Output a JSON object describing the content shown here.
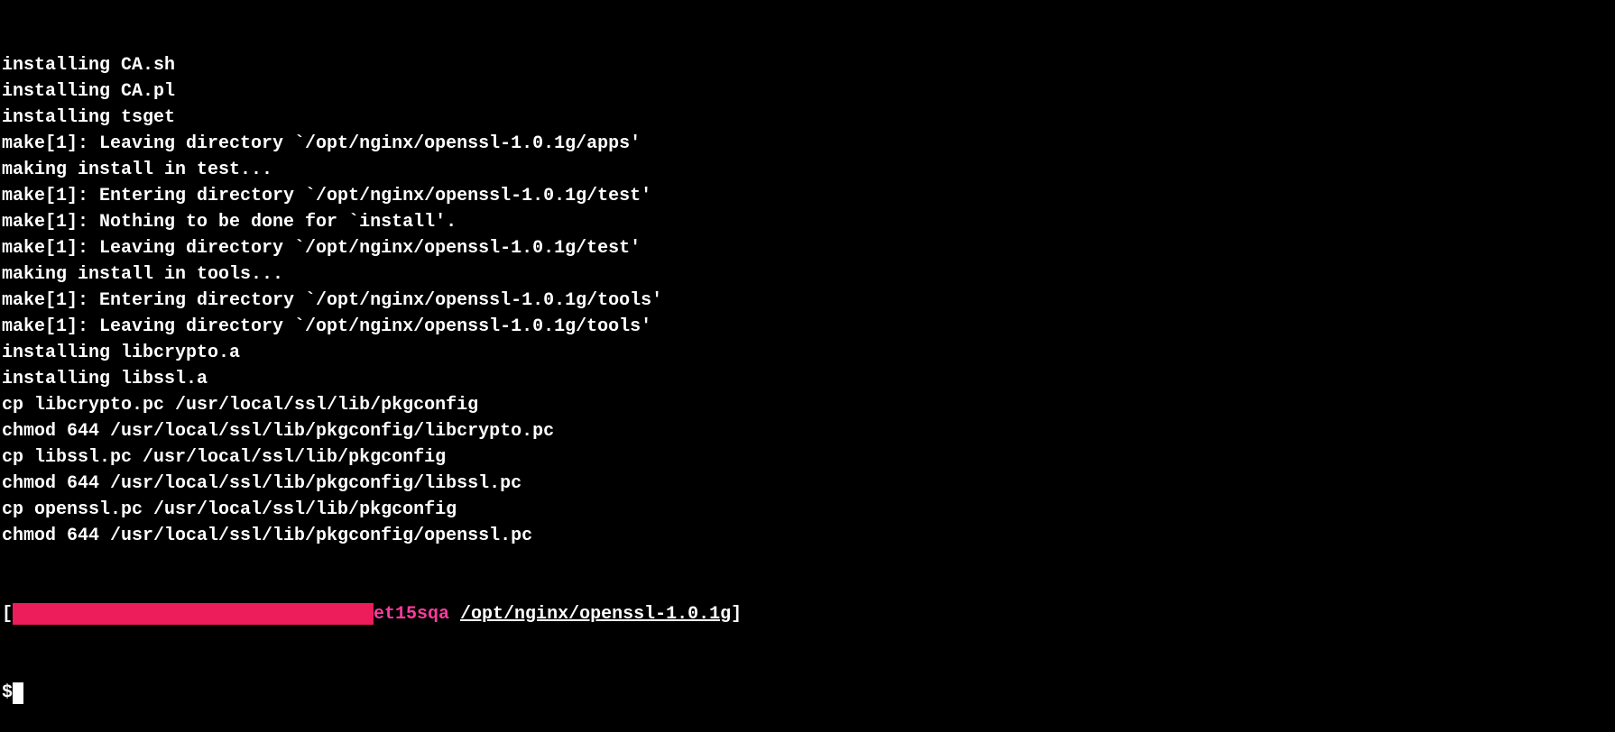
{
  "output_lines": [
    "installing CA.sh",
    "installing CA.pl",
    "installing tsget",
    "make[1]: Leaving directory `/opt/nginx/openssl-1.0.1g/apps'",
    "making install in test...",
    "make[1]: Entering directory `/opt/nginx/openssl-1.0.1g/test'",
    "make[1]: Nothing to be done for `install'.",
    "make[1]: Leaving directory `/opt/nginx/openssl-1.0.1g/test'",
    "making install in tools...",
    "make[1]: Entering directory `/opt/nginx/openssl-1.0.1g/tools'",
    "make[1]: Leaving directory `/opt/nginx/openssl-1.0.1g/tools'",
    "installing libcrypto.a",
    "installing libssl.a",
    "cp libcrypto.pc /usr/local/ssl/lib/pkgconfig",
    "chmod 644 /usr/local/ssl/lib/pkgconfig/libcrypto.pc",
    "cp libssl.pc /usr/local/ssl/lib/pkgconfig",
    "chmod 644 /usr/local/ssl/lib/pkgconfig/libssl.pc",
    "cp openssl.pc /usr/local/ssl/lib/pkgconfig",
    "chmod 644 /usr/local/ssl/lib/pkgconfig/openssl.pc",
    ""
  ],
  "prompt": {
    "open_bracket": "[",
    "host_suffix": "et15sqa",
    "cwd": "/opt/nginx/openssl-1.0.1g",
    "close_bracket": "]",
    "symbol": "$"
  }
}
